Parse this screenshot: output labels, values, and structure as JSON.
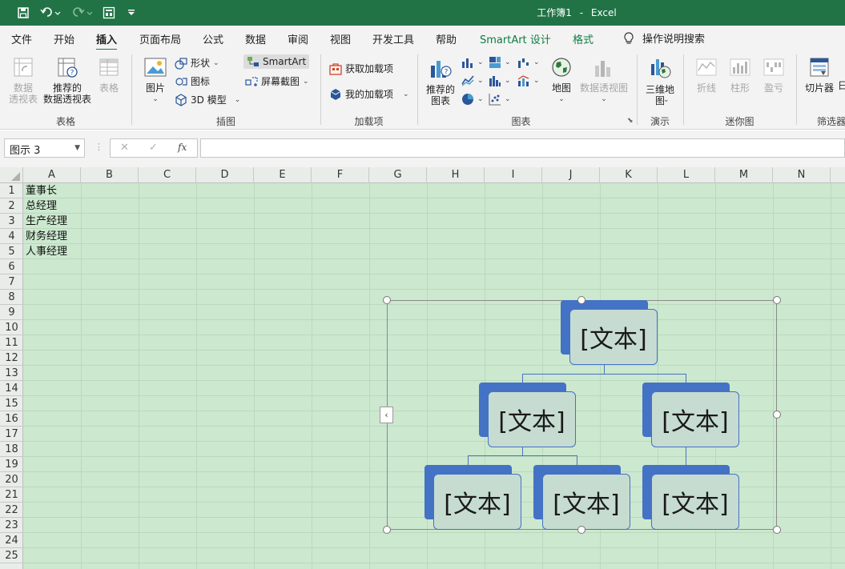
{
  "titlebar": {
    "title": "工作簿1",
    "separator": "-",
    "app": "Excel",
    "bg_color": "#217346"
  },
  "tabs": [
    {
      "label": "文件"
    },
    {
      "label": "开始"
    },
    {
      "label": "插入",
      "active": true
    },
    {
      "label": "页面布局"
    },
    {
      "label": "公式"
    },
    {
      "label": "数据"
    },
    {
      "label": "审阅"
    },
    {
      "label": "视图"
    },
    {
      "label": "开发工具"
    },
    {
      "label": "帮助"
    },
    {
      "label": "SmartArt 设计"
    },
    {
      "label": "格式"
    }
  ],
  "tellme": "操作说明搜索",
  "ribbon": {
    "tables": {
      "pivot": "数据\n透视表",
      "recommended_pivot": "推荐的\n数据透视表",
      "table": "表格",
      "group": "表格"
    },
    "illustrations": {
      "pictures": "图片",
      "shapes": "形状",
      "icons": "图标",
      "model3d": "3D 模型",
      "smartart": "SmartArt",
      "screenshot": "屏幕截图",
      "group": "插图"
    },
    "addins": {
      "get": "获取加载项",
      "mine": "我的加载项",
      "group": "加载项"
    },
    "charts": {
      "recommended": "推荐的\n图表",
      "maps": "地图",
      "pivotchart": "数据透视图",
      "group": "图表"
    },
    "tours": {
      "map3d": "三维地\n图",
      "group": "演示"
    },
    "sparklines": {
      "line": "折线",
      "column": "柱形",
      "winloss": "盈亏",
      "group": "迷你图"
    },
    "filters": {
      "slicer": "切片器",
      "timeline": "日",
      "group": "筛选器"
    }
  },
  "formula_bar": {
    "name_box": "图示 3",
    "cancel": "✕",
    "enter": "✓",
    "fx": "fx",
    "value": ""
  },
  "columns": [
    "A",
    "B",
    "C",
    "D",
    "E",
    "F",
    "G",
    "H",
    "I",
    "J",
    "K",
    "L",
    "M",
    "N"
  ],
  "rows": [
    "1",
    "2",
    "3",
    "4",
    "5",
    "6",
    "7",
    "8",
    "9",
    "10",
    "11",
    "12",
    "13",
    "14",
    "15",
    "16",
    "17",
    "18",
    "19",
    "20",
    "21",
    "22",
    "23",
    "24",
    "25"
  ],
  "cells": {
    "A1": "董事长",
    "A2": "总经理",
    "A3": "生产经理",
    "A4": "财务经理",
    "A5": "人事经理"
  },
  "smartart": {
    "nodes": [
      "[文本]",
      "[文本]",
      "[文本]",
      "[文本]",
      "[文本]",
      "[文本]"
    ],
    "accent_color": "#4472c4",
    "fill_color": "#c6dcd0"
  }
}
